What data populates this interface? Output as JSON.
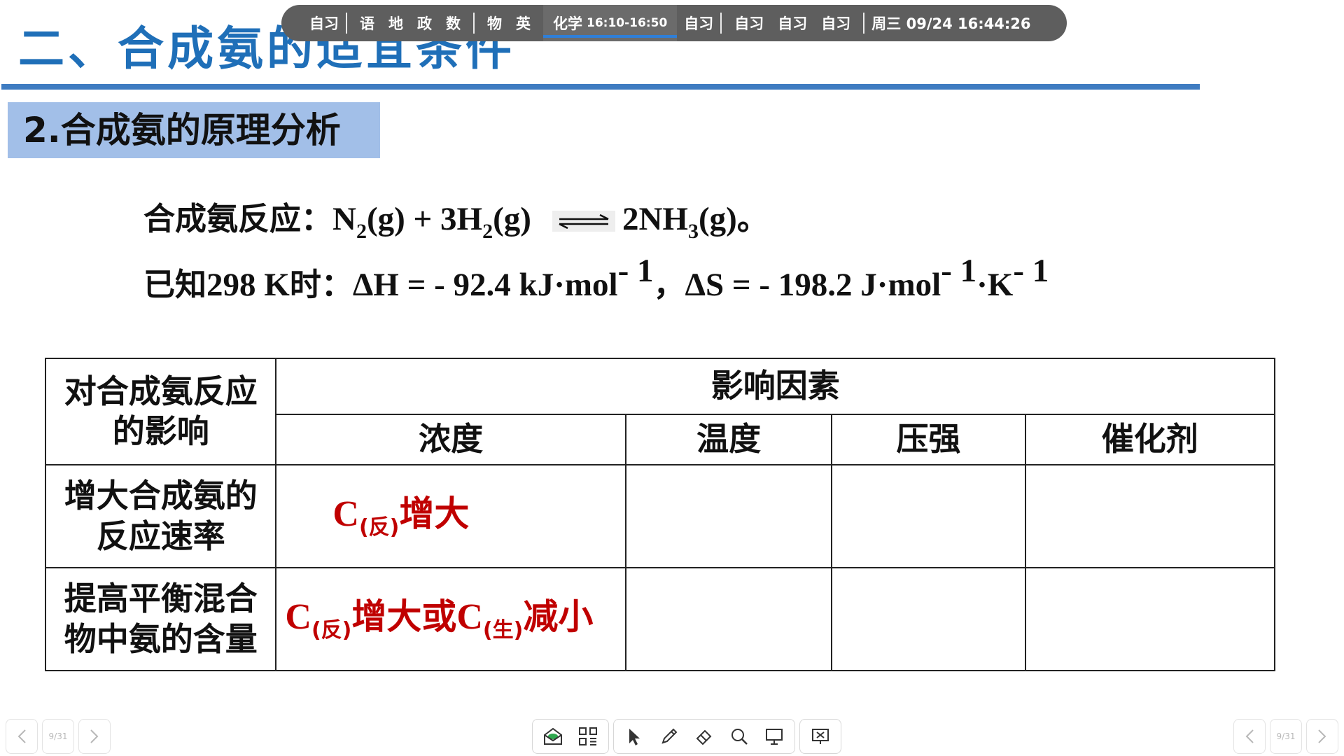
{
  "slide": {
    "title": "二、合成氨的适宜条件",
    "section_heading": "2.合成氨的原理分析",
    "reaction_label": "合成氨反应：",
    "reaction_lhs": [
      "N",
      "2",
      "(g) + 3H",
      "2",
      "(g)"
    ],
    "reaction_rhs": [
      "2NH",
      "3",
      "(g)",
      "。"
    ],
    "known_label": "已知",
    "known_conditions": [
      "298 K",
      "时：",
      "ΔH = - 92.4 kJ·mol",
      "- 1",
      "，",
      "ΔS = - 198.2 J·mol",
      "- 1",
      "·K",
      "- 1"
    ],
    "table": {
      "corner_header": "对合成氨反应的影响",
      "group_header": "影响因素",
      "column_headers": [
        "浓度",
        "温度",
        "压强",
        "催化剂"
      ],
      "rows": [
        {
          "label": "增大合成氨的反应速率",
          "cells": [
            "C(反)增大",
            "",
            "",
            ""
          ]
        },
        {
          "label": "提高平衡混合物中氨的含量",
          "cells": [
            "C(反)增大或C(生)减小",
            "",
            "",
            ""
          ]
        }
      ],
      "cell_parts": {
        "r1c1": [
          "C",
          "(反)",
          "增大"
        ],
        "r2c1": [
          "C",
          "(反)",
          "增大或",
          "C",
          "(生)",
          "减小"
        ]
      }
    }
  },
  "schedule": {
    "group1": [
      "自习"
    ],
    "group2": [
      "语",
      "地",
      "政",
      "数"
    ],
    "group3": [
      "物",
      "英"
    ],
    "active_subject": "化学",
    "active_time": "16:10-16:50",
    "group4": [
      "自习"
    ],
    "group5": [
      "自习",
      "自习",
      "自习"
    ],
    "date_time": "周三 09/24  16:44:26"
  },
  "navigation": {
    "page_indicator_left": "9/31",
    "page_indicator_right": "9/31"
  },
  "icons": [
    "prev-arrow-icon",
    "next-arrow-icon",
    "whiteboard-icon",
    "apps-grid-icon",
    "cursor-icon",
    "pen-icon",
    "eraser-icon",
    "search-icon",
    "screen-cast-icon",
    "close-presentation-icon"
  ],
  "colors": {
    "title_blue": "#1f6fb8",
    "rule_blue": "#3f7cc1",
    "heading_bg": "#a2bfe8",
    "answer_red": "#c00000",
    "schedule_bg": "#5e5e5e",
    "active_underline": "#2f7fd8"
  }
}
